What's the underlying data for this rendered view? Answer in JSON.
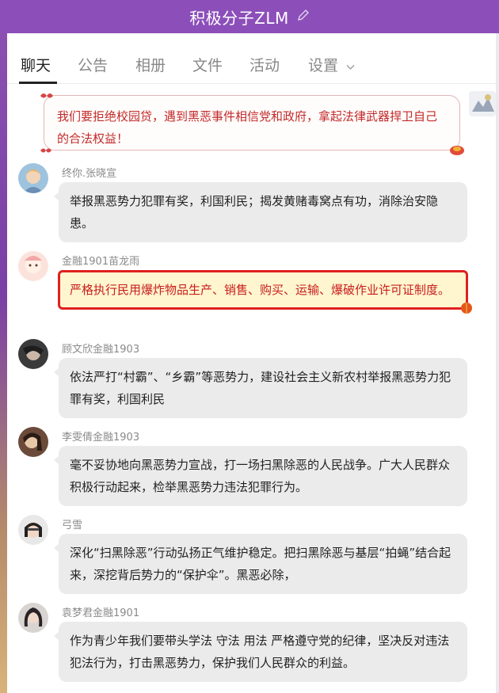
{
  "window": {
    "title": "积极分子ZLM",
    "edit_icon": "pencil-icon"
  },
  "tabs": [
    {
      "label": "聊天",
      "active": true
    },
    {
      "label": "公告",
      "active": false
    },
    {
      "label": "相册",
      "active": false
    },
    {
      "label": "文件",
      "active": false
    },
    {
      "label": "活动",
      "active": false
    },
    {
      "label": "设置",
      "active": false
    }
  ],
  "colors": {
    "title_bar": "#8c4fba",
    "bubble_gray": "#ebebeb",
    "bubble_red_border": "#e02020",
    "bubble_red_bg": "#fff6cf",
    "red_text": "#c22a2a"
  },
  "messages": [
    {
      "sender": "",
      "text": "我们要拒绝校园贷，遇到黑恶事件相信党和政府，拿起法律武器捍卫自己的合法权益！",
      "style": "self-decorated"
    },
    {
      "sender": "终你.张晓宣",
      "text": "举报黑恶势力犯罪有奖，利国利民；揭发黄赌毒窝点有功，消除治安隐患。",
      "style": "normal"
    },
    {
      "sender": "金融1901苗龙雨",
      "text": "严格执行民用爆炸物品生产、销售、购买、运输、爆破作业许可证制度。",
      "style": "red"
    },
    {
      "sender": "顾文欣金融1903",
      "text": "依法严打“村霸”、“乡霸”等恶势力，建设社会主义新农村举报黑恶势力犯罪有奖，利国利民",
      "style": "normal"
    },
    {
      "sender": "李雯倩金融1903",
      "text": "毫不妥协地向黑恶势力宣战，打一场扫黑除恶的人民战争。广大人民群众积极行动起来，检举黑恶势力违法犯罪行为。",
      "style": "normal"
    },
    {
      "sender": "弓雪",
      "text": "深化“扫黑除恶”行动弘扬正气维护稳定。把扫黑除恶与基层“拍蝇”结合起来，深挖背后势力的“保护伞”。黑恶必除，",
      "style": "normal"
    },
    {
      "sender": "袁梦君金融1901",
      "text": "作为青少年我们要带头学法 守法 用法 严格遵守党的纪律，坚决反对违法犯法行为，打击黑恶势力，保护我们人民群众的利益。",
      "style": "normal"
    }
  ]
}
